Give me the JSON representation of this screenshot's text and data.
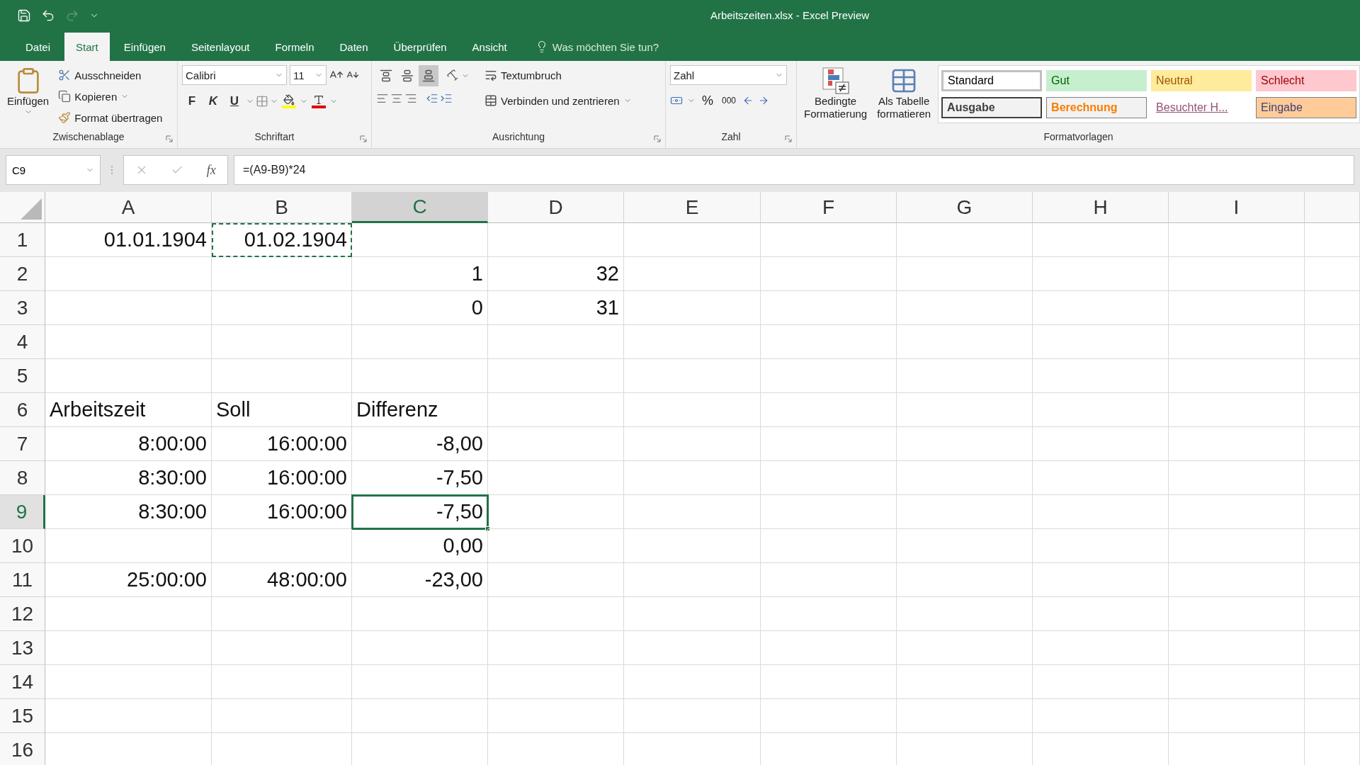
{
  "title_bar": {
    "title": "Arbeitszeiten.xlsx  -  Excel Preview"
  },
  "tabs": [
    {
      "label": "Datei",
      "selected": false
    },
    {
      "label": "Start",
      "selected": true
    },
    {
      "label": "Einfügen",
      "selected": false
    },
    {
      "label": "Seitenlayout",
      "selected": false
    },
    {
      "label": "Formeln",
      "selected": false
    },
    {
      "label": "Daten",
      "selected": false
    },
    {
      "label": "Überprüfen",
      "selected": false
    },
    {
      "label": "Ansicht",
      "selected": false
    }
  ],
  "tell_me": {
    "placeholder": "Was möchten Sie tun?"
  },
  "ribbon": {
    "clipboard": {
      "paste": "Einfügen",
      "cut": "Ausschneiden",
      "copy": "Kopieren",
      "format_painter": "Format übertragen",
      "label": "Zwischenablage"
    },
    "font": {
      "name": "Calibri",
      "size": "11",
      "bold": "F",
      "italic": "K",
      "underline": "U",
      "label": "Schriftart"
    },
    "alignment": {
      "vertical": [
        {
          "selected": false
        },
        {
          "selected": false
        },
        {
          "selected": true
        }
      ],
      "wrap": "Textumbruch",
      "merge": "Verbinden und zentrieren",
      "label": "Ausrichtung"
    },
    "number": {
      "format": "Zahl",
      "percent": "%",
      "thousands": "000",
      "label": "Zahl"
    },
    "styles": {
      "conditional": [
        "Bedingte",
        "Formatierung"
      ],
      "as_table": [
        "Als Tabelle",
        "formatieren"
      ],
      "label": "Formatvorlagen",
      "gallery": [
        {
          "label": "Standard",
          "kind": "standard",
          "color": "#ffffff",
          "selected": true
        },
        {
          "label": "Gut",
          "kind": "good",
          "color": "#c6efce",
          "selected": false
        },
        {
          "label": "Neutral",
          "kind": "neutral",
          "color": "#ffeb9c",
          "selected": false
        },
        {
          "label": "Schlecht",
          "kind": "bad",
          "color": "#ffc7ce",
          "selected": false
        },
        {
          "label": "Ausgabe",
          "kind": "output",
          "color": "#f2f2f2",
          "selected": false
        },
        {
          "label": "Berechnung",
          "kind": "calc",
          "color": "#f2f2f2",
          "selected": false
        },
        {
          "label": "Besuchter H...",
          "kind": "link",
          "color": "#ffffff",
          "selected": false
        },
        {
          "label": "Eingabe",
          "kind": "input",
          "color": "#ffcc99",
          "selected": false
        }
      ]
    }
  },
  "formula_bar": {
    "name_box": "C9",
    "function_label": "fx",
    "formula": "=(A9-B9)*24"
  },
  "sheet": {
    "columns": [
      {
        "label": "A",
        "selected": false
      },
      {
        "label": "B",
        "selected": false
      },
      {
        "label": "C",
        "selected": true
      },
      {
        "label": "D",
        "selected": false
      },
      {
        "label": "E",
        "selected": false
      },
      {
        "label": "F",
        "selected": false
      },
      {
        "label": "G",
        "selected": false
      },
      {
        "label": "H",
        "selected": false
      },
      {
        "label": "I",
        "selected": false
      }
    ],
    "rows": [
      {
        "label": "1",
        "selected": false,
        "cells": [
          {
            "text": "01.01.1904",
            "kind": "number",
            "selected": false,
            "copied": false
          },
          {
            "text": "01.02.1904",
            "kind": "number",
            "selected": false,
            "copied": true
          }
        ]
      },
      {
        "label": "2",
        "selected": false,
        "cells": [
          null,
          null,
          {
            "text": "1",
            "kind": "number",
            "selected": false,
            "copied": false
          },
          {
            "text": "32",
            "kind": "number",
            "selected": false,
            "copied": false
          }
        ]
      },
      {
        "label": "3",
        "selected": false,
        "cells": [
          null,
          null,
          {
            "text": "0",
            "kind": "number",
            "selected": false,
            "copied": false
          },
          {
            "text": "31",
            "kind": "number",
            "selected": false,
            "copied": false
          }
        ]
      },
      {
        "label": "4",
        "selected": false
      },
      {
        "label": "5",
        "selected": false
      },
      {
        "label": "6",
        "selected": false,
        "cells": [
          {
            "text": "Arbeitszeit",
            "kind": "text",
            "selected": false,
            "copied": false
          },
          {
            "text": "Soll",
            "kind": "text",
            "selected": false,
            "copied": false
          },
          {
            "text": "Differenz",
            "kind": "text",
            "selected": false,
            "copied": false
          }
        ]
      },
      {
        "label": "7",
        "selected": false,
        "cells": [
          {
            "text": "8:00:00",
            "kind": "number",
            "selected": false,
            "copied": false
          },
          {
            "text": "16:00:00",
            "kind": "number",
            "selected": false,
            "copied": false
          },
          {
            "text": "-8,00",
            "kind": "number",
            "selected": false,
            "copied": false
          }
        ]
      },
      {
        "label": "8",
        "selected": false,
        "cells": [
          {
            "text": "8:30:00",
            "kind": "number",
            "selected": false,
            "copied": false
          },
          {
            "text": "16:00:00",
            "kind": "number",
            "selected": false,
            "copied": false
          },
          {
            "text": "-7,50",
            "kind": "number",
            "selected": false,
            "copied": false
          }
        ]
      },
      {
        "label": "9",
        "selected": true,
        "cells": [
          {
            "text": "8:30:00",
            "kind": "number",
            "selected": false,
            "copied": false
          },
          {
            "text": "16:00:00",
            "kind": "number",
            "selected": false,
            "copied": false
          },
          {
            "text": "-7,50",
            "kind": "number",
            "selected": true,
            "copied": false
          }
        ]
      },
      {
        "label": "10",
        "selected": false,
        "cells": [
          null,
          null,
          {
            "text": "0,00",
            "kind": "number",
            "selected": false,
            "copied": false
          }
        ]
      },
      {
        "label": "11",
        "selected": false,
        "cells": [
          {
            "text": "25:00:00",
            "kind": "number",
            "selected": false,
            "copied": false
          },
          {
            "text": "48:00:00",
            "kind": "number",
            "selected": false,
            "copied": false
          },
          {
            "text": "-23,00",
            "kind": "number",
            "selected": false,
            "copied": false
          }
        ]
      },
      {
        "label": "12",
        "selected": false
      },
      {
        "label": "13",
        "selected": false
      },
      {
        "label": "14",
        "selected": false
      },
      {
        "label": "15",
        "selected": false
      },
      {
        "label": "16",
        "selected": false
      }
    ]
  }
}
